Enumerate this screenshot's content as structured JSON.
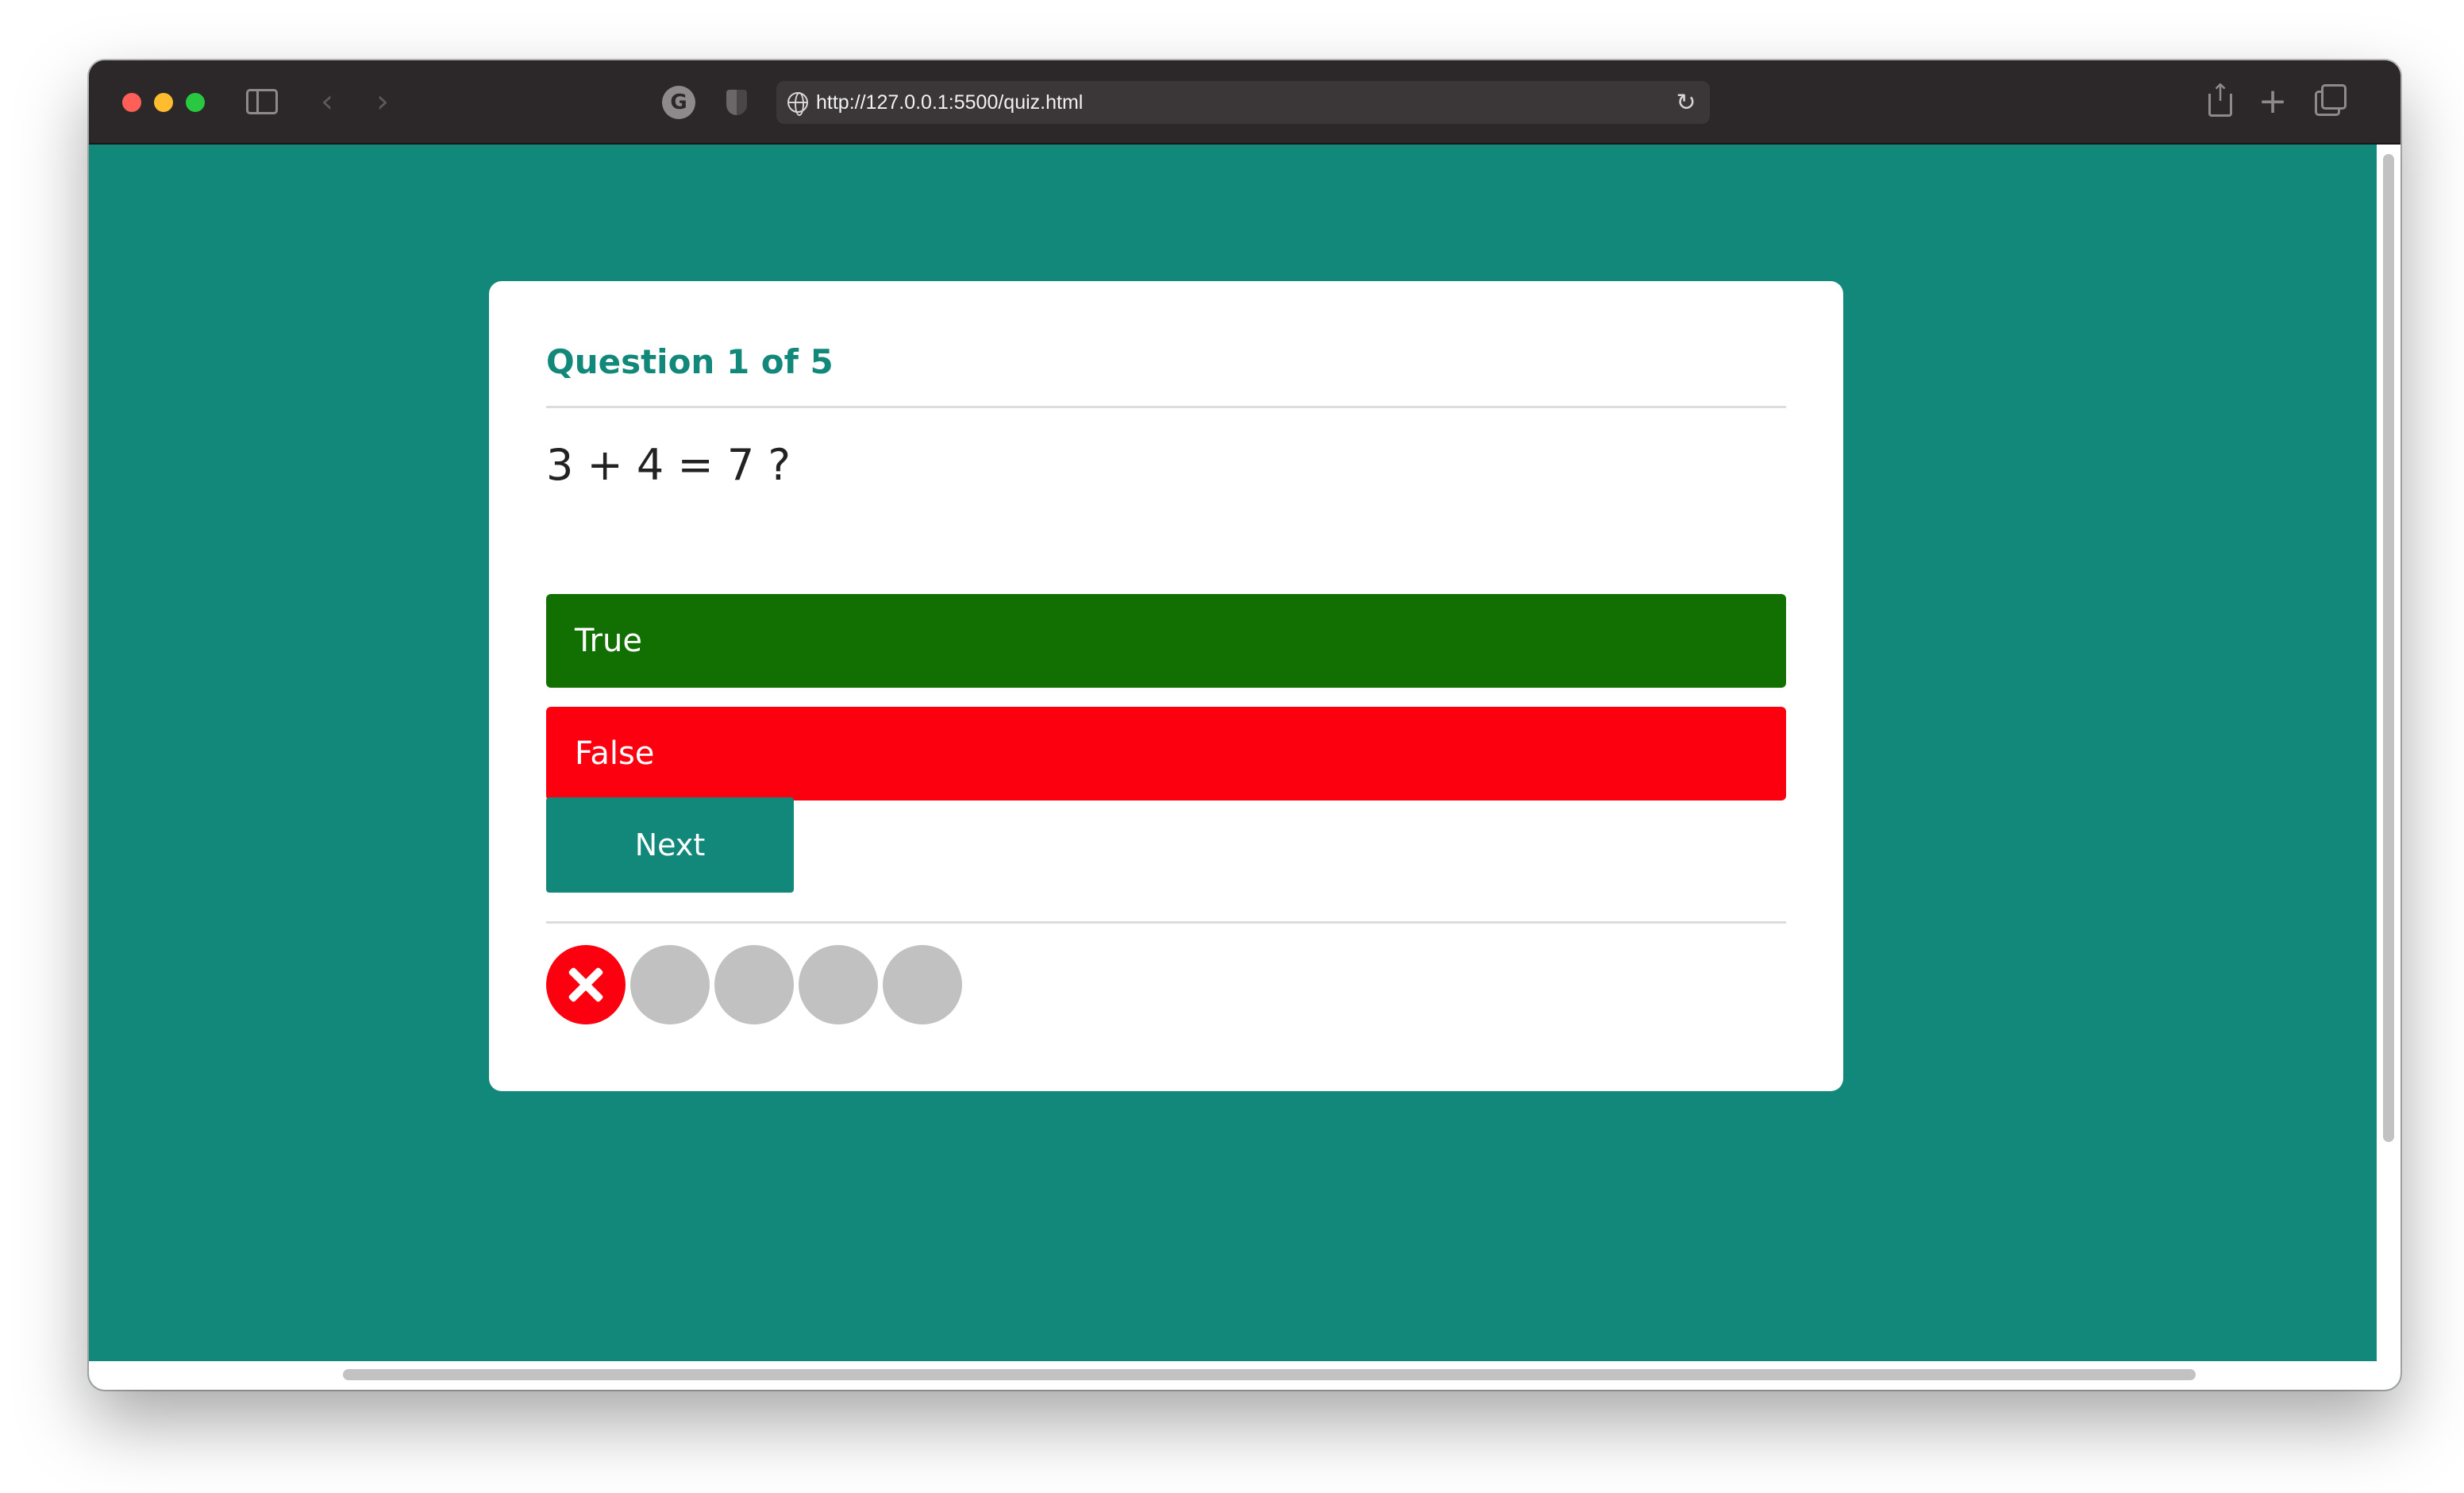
{
  "browser": {
    "url": "http://127.0.0.1:5500/quiz.html",
    "icons": [
      "sidebar-icon",
      "back-icon",
      "forward-icon",
      "extension-icon",
      "shield-icon",
      "globe-icon",
      "reload-icon",
      "share-icon",
      "new-tab-icon",
      "tabs-overview-icon"
    ]
  },
  "quiz": {
    "counter": "Question 1 of 5",
    "question": "3 + 4 = 7 ?",
    "answers": [
      {
        "label": "True",
        "color": "#127002"
      },
      {
        "label": "False",
        "color": "#fc0010"
      }
    ],
    "next_label": "Next",
    "progress": [
      {
        "state": "wrong",
        "icon": "x-icon",
        "color": "#fc0010"
      },
      {
        "state": "pending",
        "color": "#c1c1c1"
      },
      {
        "state": "pending",
        "color": "#c1c1c1"
      },
      {
        "state": "pending",
        "color": "#c1c1c1"
      },
      {
        "state": "pending",
        "color": "#c1c1c1"
      }
    ]
  },
  "colors": {
    "page_background": "#12887a",
    "accent": "#12887a",
    "titlebar": "#2c2728"
  }
}
